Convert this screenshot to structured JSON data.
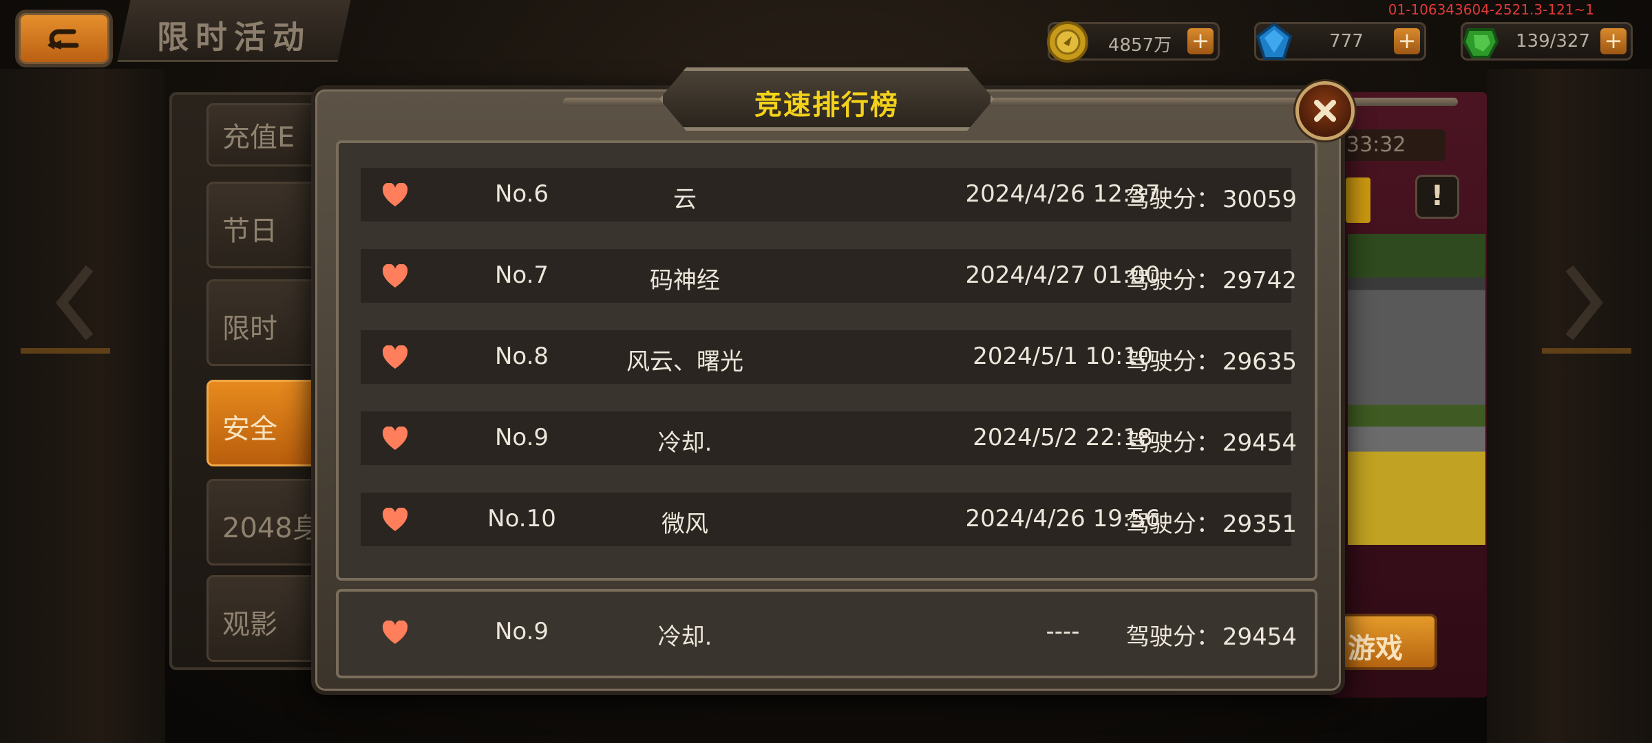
{
  "header": {
    "title": "限时活动",
    "session_code": "01-106343604-2521.3-121~1"
  },
  "currencies": [
    {
      "icon": "gold-coin-icon",
      "value": "4857万",
      "plus": "+"
    },
    {
      "icon": "blue-gem-icon",
      "value": "777",
      "plus": "+"
    },
    {
      "icon": "green-energy-icon",
      "value": "139/327",
      "plus": "+"
    }
  ],
  "side_menu": {
    "items": [
      {
        "label": "充值E"
      },
      {
        "label": "节日"
      },
      {
        "label": "限时"
      },
      {
        "label": "安全"
      },
      {
        "label": "2048身"
      },
      {
        "label": "观影"
      }
    ],
    "active_index": 3
  },
  "event_panel": {
    "timer_text": "33:32",
    "info_label": "!",
    "play_label": "游戏"
  },
  "leaderboard": {
    "title": "竞速排行榜",
    "score_label": "驾驶分：",
    "rows": [
      {
        "rank": "No.6",
        "name": "云",
        "time": "2024/4/26 12:37",
        "score": "30059"
      },
      {
        "rank": "No.7",
        "name": "码神经",
        "time": "2024/4/27 01:00",
        "score": "29742"
      },
      {
        "rank": "No.8",
        "name": "风云、曙光",
        "time": "2024/5/1 10:10",
        "score": "29635"
      },
      {
        "rank": "No.9",
        "name": "冷却.",
        "time": "2024/5/2 22:18",
        "score": "29454"
      },
      {
        "rank": "No.10",
        "name": "微风",
        "time": "2024/4/26 19:56",
        "score": "29351"
      }
    ],
    "self_row": {
      "rank": "No.9",
      "name": "冷却.",
      "time": "----",
      "score": "29454"
    }
  },
  "colors": {
    "title_yellow": "#f4d21a",
    "heart": "#ff7e5b",
    "accent_orange": "#e68a1e",
    "session_red": "#e23a3a"
  }
}
